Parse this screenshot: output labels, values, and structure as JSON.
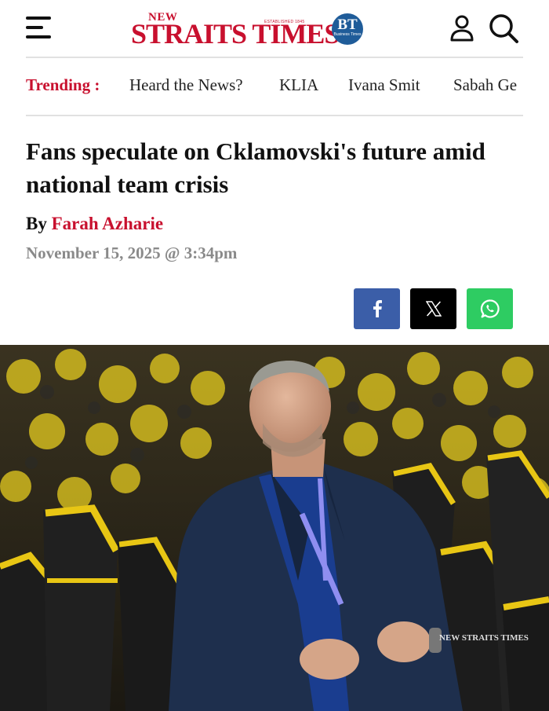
{
  "header": {
    "logo_new": "NEW",
    "logo_main": "STRAITS TIMES",
    "logo_est": "ESTABLISHED 1845",
    "bt_badge": "BT",
    "bt_badge_sub": "Business Times"
  },
  "trending": {
    "label": "Trending :",
    "items": [
      "Heard the News?",
      "KLIA",
      "Ivana Smit",
      "Sabah Ge"
    ]
  },
  "article": {
    "headline": "Fans speculate on Cklamovski's future amid national team crisis",
    "byline_prefix": "By",
    "author": "Farah Azharie",
    "date": "November 15, 2025 @ 3:34pm"
  },
  "share": {
    "facebook_label": "f"
  },
  "image": {
    "watermark": "NEW STRAITS TIMES"
  },
  "colors": {
    "brand_red": "#c8102e",
    "bt_blue": "#1f5c99",
    "facebook": "#3b5ea8",
    "x": "#000000",
    "whatsapp": "#2ecc62"
  },
  "icons": [
    "menu-icon",
    "user-icon",
    "search-icon",
    "facebook-icon",
    "x-icon",
    "whatsapp-icon"
  ]
}
